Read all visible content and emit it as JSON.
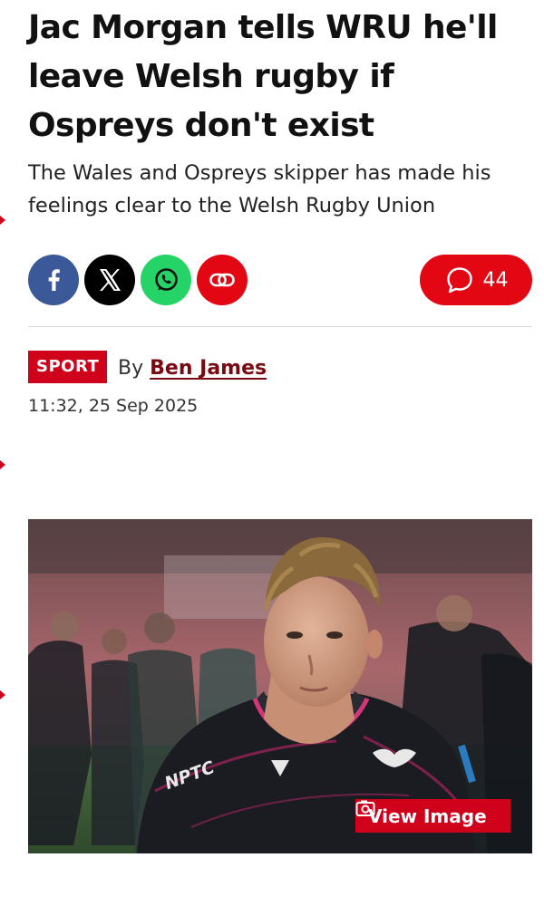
{
  "article": {
    "headline": "Jac Morgan tells WRU he'll leave Welsh rugby if Ospreys don't exist",
    "standfirst": "The Wales and Ospreys skipper has made his feelings clear to the Welsh Rugby Union"
  },
  "share": {
    "buttons": [
      {
        "network": "facebook",
        "icon": "facebook-icon",
        "color": "#3b5998"
      },
      {
        "network": "x",
        "icon": "x-icon",
        "color": "#000000"
      },
      {
        "network": "whatsapp",
        "icon": "whatsapp-icon",
        "color": "#25d366"
      },
      {
        "network": "copy-link",
        "icon": "link-icon",
        "color": "#e30613"
      }
    ],
    "comments_count": "44"
  },
  "meta": {
    "section": "SPORT",
    "by_prefix": "By",
    "author": "Ben James",
    "timestamp": "11:32, 25 Sep 2025"
  },
  "hero_image": {
    "view_label": "View Image",
    "shirt_sponsor": "NPTC"
  },
  "colors": {
    "brand_red": "#d0021b",
    "comment_red": "#e30613",
    "author_link": "#7a0a12"
  }
}
